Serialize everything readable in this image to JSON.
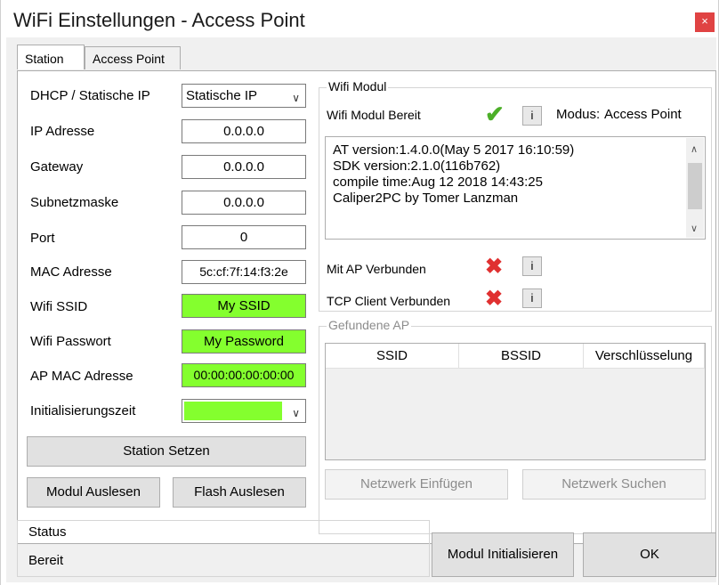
{
  "window": {
    "title": "WiFi Einstellungen - Access Point",
    "close": "×"
  },
  "tabs": [
    "Station",
    "Access Point"
  ],
  "form": {
    "dhcp_label": "DHCP / Statische IP",
    "dhcp_value": "Statische IP",
    "ip_label": "IP Adresse",
    "ip_value": "0.0.0.0",
    "gateway_label": "Gateway",
    "gateway_value": "0.0.0.0",
    "subnet_label": "Subnetzmaske",
    "subnet_value": "0.0.0.0",
    "port_label": "Port",
    "port_value": "0",
    "mac_label": "MAC Adresse",
    "mac_value": "5c:cf:7f:14:f3:2e",
    "ssid_label": "Wifi SSID",
    "ssid_value": "My SSID",
    "pass_label": "Wifi Passwort",
    "pass_value": "My Password",
    "apmac_label": "AP MAC Adresse",
    "apmac_value": "00:00:00:00:00:00",
    "init_label": "Initialisierungszeit",
    "init_value": ""
  },
  "buttons": {
    "station_setzen": "Station Setzen",
    "modul_auslesen": "Modul Auslesen",
    "flash_auslesen": "Flash Auslesen",
    "netzwerk_einfuegen": "Netzwerk Einfügen",
    "netzwerk_suchen": "Netzwerk Suchen",
    "modul_init": "Modul Initialisieren",
    "ok": "OK",
    "info": "i"
  },
  "wifi_modul": {
    "title": "Wifi Modul",
    "bereit_label": "Wifi Modul Bereit",
    "modus_label": "Modus:",
    "modus_value": "Access Point",
    "lines": [
      "AT version:1.4.0.0(May  5 2017 16:10:59)",
      "SDK version:2.1.0(116b762)",
      "compile time:Aug 12 2018 14:43:25",
      "Caliper2PC by Tomer Lanzman"
    ],
    "ap_connected_label": "Mit AP Verbunden",
    "tcp_connected_label": "TCP Client Verbunden"
  },
  "found_ap": {
    "title": "Gefundene AP",
    "columns": [
      "SSID",
      "BSSID",
      "Verschlüsselung"
    ]
  },
  "status": {
    "title": "Status",
    "value": "Bereit"
  },
  "icons": {
    "check_color": "#4caf28",
    "cross_color": "#e03030",
    "green_field": "#84ff2e"
  }
}
